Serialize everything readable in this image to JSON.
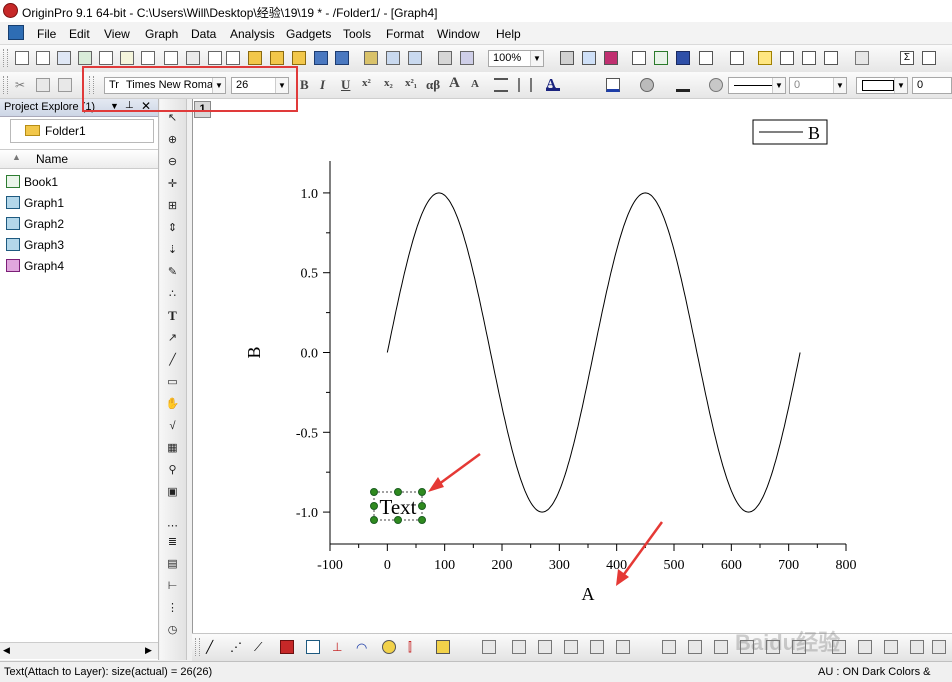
{
  "window": {
    "title": "OriginPro 9.1 64-bit - C:\\Users\\Will\\Desktop\\经验\\19\\19 * - /Folder1/ - [Graph4]"
  },
  "menu": [
    "File",
    "Edit",
    "View",
    "Graph",
    "Data",
    "Analysis",
    "Gadgets",
    "Tools",
    "Format",
    "Window",
    "Help"
  ],
  "toolbar": {
    "zoom": "100%",
    "font_name": "Times New Roma",
    "font_size": "26",
    "line_width_value": "0",
    "border_value": "0",
    "format_buttons": [
      "B",
      "I",
      "U",
      "x²",
      "x₂",
      "x²₁",
      "αβ",
      "A",
      "A"
    ]
  },
  "explorer": {
    "title": "Project Explore",
    "count": "(1)",
    "folder": "Folder1",
    "column_header": "Name",
    "items": [
      {
        "label": "Book1",
        "icon": "workbook-icon"
      },
      {
        "label": "Graph1",
        "icon": "graph-icon"
      },
      {
        "label": "Graph2",
        "icon": "graph-icon"
      },
      {
        "label": "Graph3",
        "icon": "graph-icon"
      },
      {
        "label": "Graph4",
        "icon": "graph-icon-active"
      }
    ]
  },
  "graph": {
    "layer_tab": "1",
    "text_object": "Text",
    "colors": {
      "line": "#000000",
      "selection_handles": "#2f8a1f",
      "annotation_arrows": "#e53935",
      "highlight": "#e03a3a"
    }
  },
  "chart_data": {
    "type": "line",
    "xlabel": "A",
    "ylabel": "B",
    "xlim": [
      -100,
      800
    ],
    "ylim": [
      -1.2,
      1.2
    ],
    "x_ticks": [
      "-100",
      "0",
      "100",
      "200",
      "300",
      "400",
      "500",
      "600",
      "700",
      "800"
    ],
    "y_ticks": [
      "1.0",
      "0.5",
      "0.0",
      "-0.5",
      "-1.0"
    ],
    "legend": "top-right",
    "grid": false,
    "series": [
      {
        "name": "B",
        "x": [
          0,
          15,
          30,
          45,
          60,
          75,
          90,
          105,
          120,
          135,
          150,
          165,
          180,
          195,
          210,
          225,
          240,
          255,
          270,
          285,
          300,
          315,
          330,
          345,
          360,
          375,
          390,
          405,
          420,
          435,
          450,
          465,
          480,
          495,
          510,
          525,
          540,
          555,
          570,
          585,
          600,
          615,
          630,
          645,
          660,
          675,
          690,
          705,
          720
        ],
        "y": [
          0,
          0.259,
          0.5,
          0.707,
          0.866,
          0.966,
          1,
          0.966,
          0.866,
          0.707,
          0.5,
          0.259,
          0,
          -0.259,
          -0.5,
          -0.707,
          -0.866,
          -0.966,
          -1,
          -0.966,
          -0.866,
          -0.707,
          -0.5,
          -0.259,
          0,
          0.259,
          0.5,
          0.707,
          0.866,
          0.966,
          1,
          0.966,
          0.866,
          0.707,
          0.5,
          0.259,
          0,
          -0.259,
          -0.5,
          -0.707,
          -0.866,
          -0.966,
          -1,
          -0.966,
          -0.866,
          -0.707,
          -0.5,
          -0.259,
          0
        ]
      }
    ]
  },
  "status": {
    "left": "Text(Attach to Layer): size(actual) = 26(26)",
    "right": "AU : ON  Dark Colors &"
  },
  "watermark": "Baidu经验"
}
